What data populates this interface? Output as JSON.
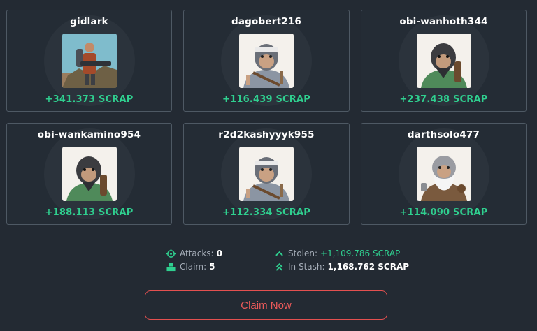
{
  "players": [
    {
      "name": "gidlark",
      "reward": "+341.373 SCRAP",
      "avatar": "soldier"
    },
    {
      "name": "dagobert216",
      "reward": "+116.439 SCRAP",
      "avatar": "monkey-grey"
    },
    {
      "name": "obi-wanhoth344",
      "reward": "+237.438 SCRAP",
      "avatar": "monkey-green"
    },
    {
      "name": "obi-wankamino954",
      "reward": "+188.113 SCRAP",
      "avatar": "monkey-green"
    },
    {
      "name": "r2d2kashyyyk955",
      "reward": "+112.334 SCRAP",
      "avatar": "monkey-grey"
    },
    {
      "name": "darthsolo477",
      "reward": "+114.090 SCRAP",
      "avatar": "monkey-white"
    }
  ],
  "stats": {
    "attacks_label": "Attacks:",
    "attacks_value": "0",
    "claim_label": "Claim:",
    "claim_value": "5",
    "stolen_label": "Stolen:",
    "stolen_value": "+1,109.786 SCRAP",
    "stash_label": "In Stash:",
    "stash_value": "1,168.762 SCRAP"
  },
  "claim_button_label": "Claim Now",
  "colors": {
    "accent_green": "#2fcf8f",
    "danger": "#e45050",
    "background": "#232a33"
  }
}
